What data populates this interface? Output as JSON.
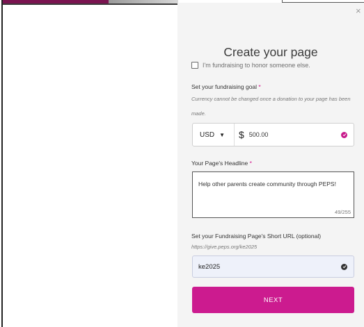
{
  "modal": {
    "close_icon": "×",
    "title": "Create your page",
    "honor_label": "I'm fundraising to honor someone else.",
    "goal": {
      "label": "Set your fundraising goal",
      "required_mark": "*",
      "help": "Currency cannot be changed once a donation to your page has been made.",
      "currency": "USD",
      "currency_symbol": "$",
      "amount": "500.00"
    },
    "headline": {
      "label": "Your Page's Headline",
      "required_mark": "*",
      "value": "Help other parents create community through PEPS!",
      "counter": "49/255"
    },
    "short_url": {
      "label": "Set your Fundraising Page's Short URL (optional)",
      "preview": "https://give.peps.org/ke2025",
      "value": "ke2025"
    },
    "next_label": "NEXT"
  },
  "colors": {
    "accent": "#cc1b8f",
    "panel_bg": "#f4f4f4",
    "header_plum": "#7a1450"
  }
}
